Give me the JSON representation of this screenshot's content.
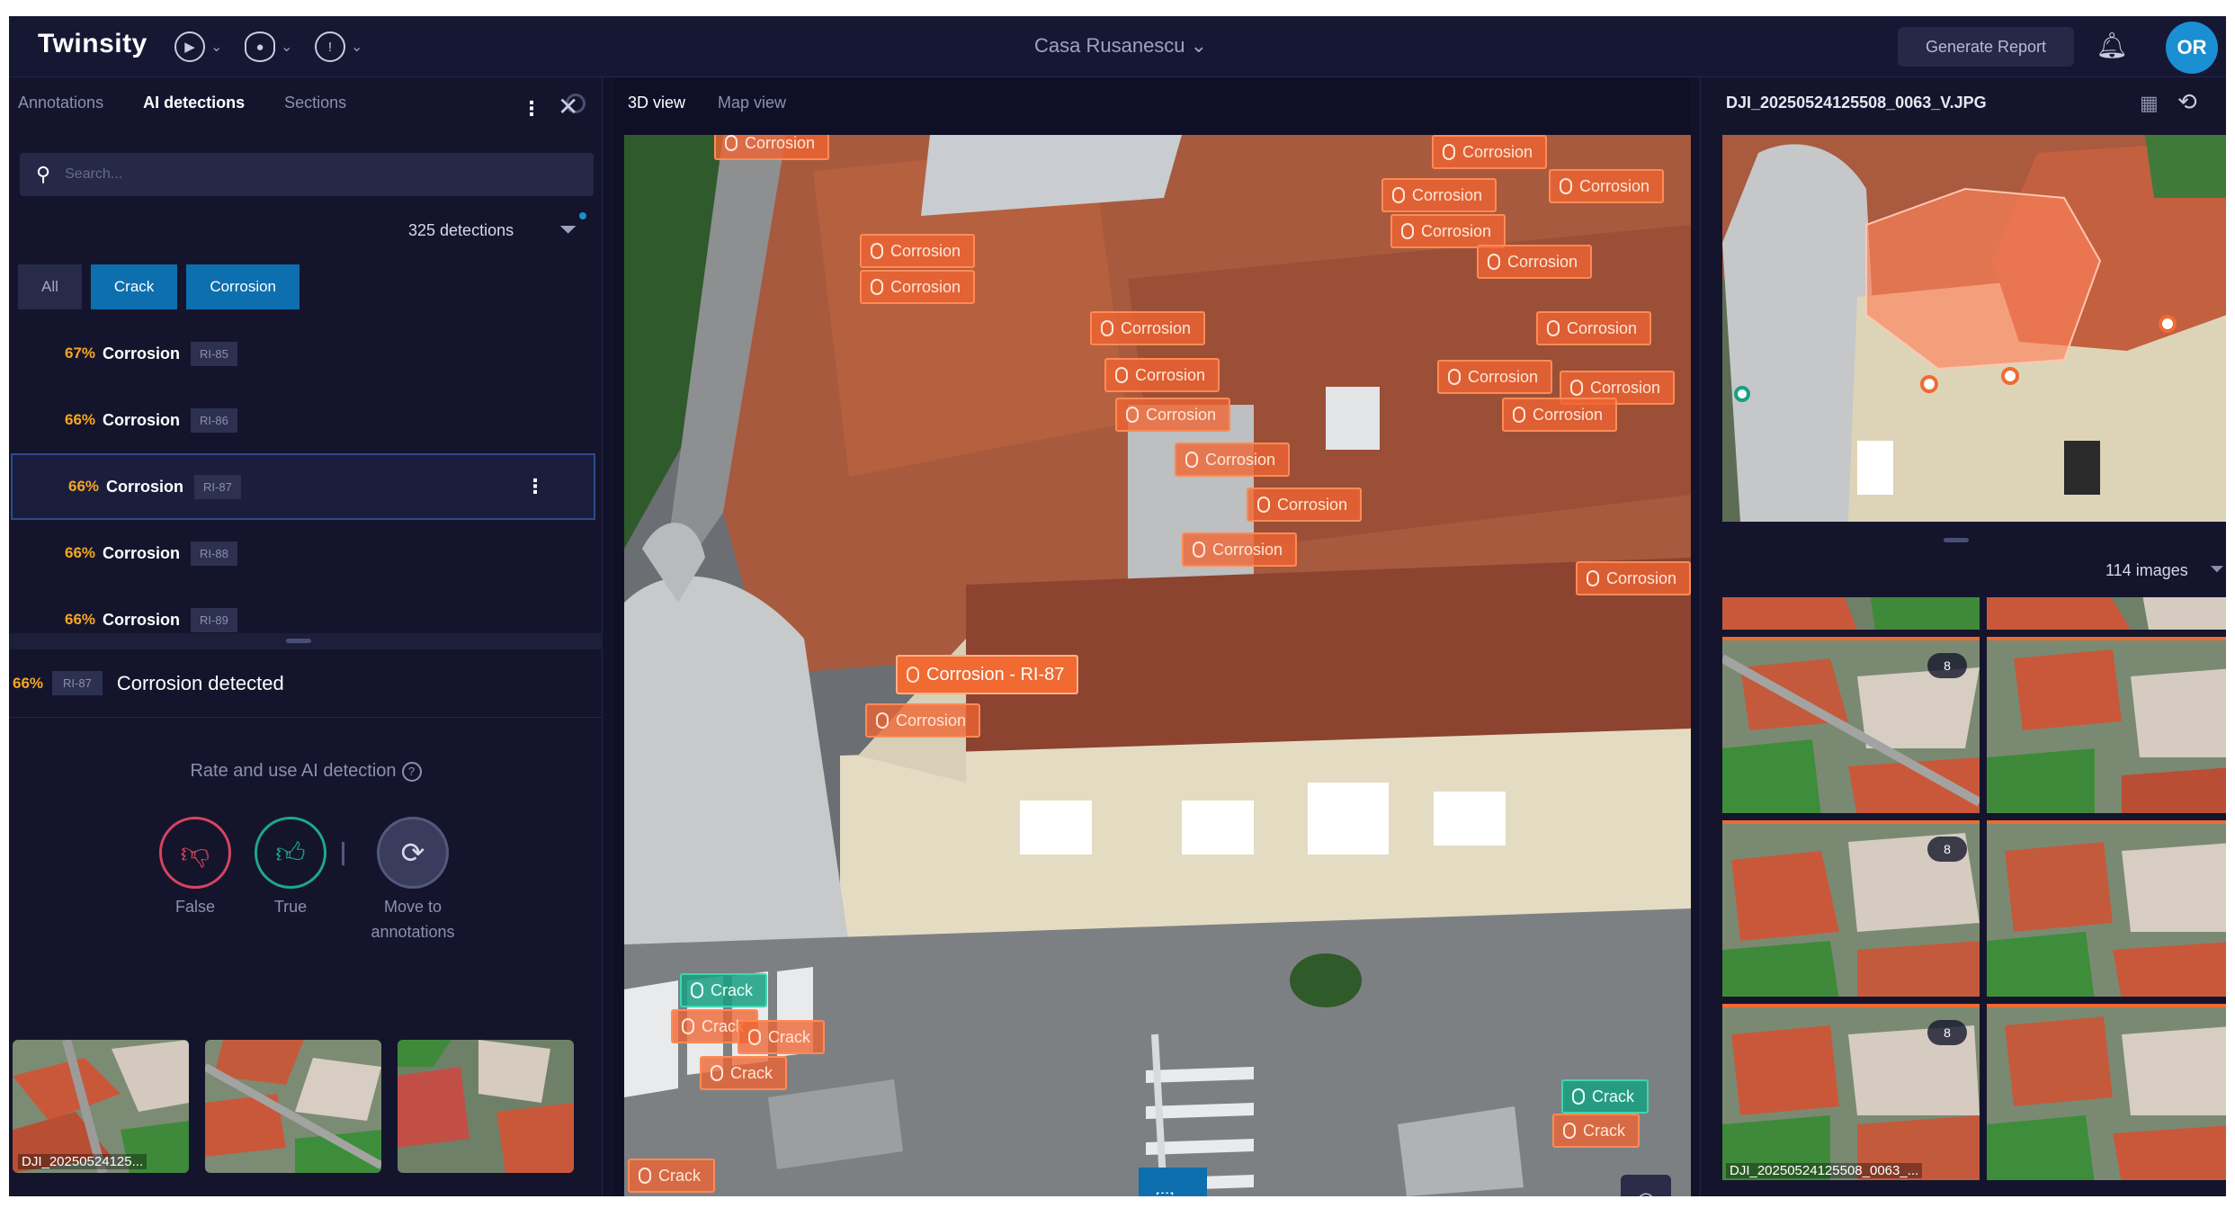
{
  "app": {
    "logo": "Twinsity",
    "project": "Casa Rusanescu ⌄",
    "generate_report": "Generate Report",
    "avatar_initials": "OR"
  },
  "left": {
    "tabs": [
      "Annotations",
      "AI detections",
      "Sections"
    ],
    "active_tab": "AI detections",
    "search_placeholder": "Search...",
    "detections_count": "325 detections",
    "filter_chips": [
      "All",
      "Crack",
      "Corrosion"
    ],
    "selected_chips": [
      "Crack",
      "Corrosion"
    ],
    "detections": [
      {
        "pct": "67%",
        "label": "Corrosion",
        "id": "RI-85"
      },
      {
        "pct": "66%",
        "label": "Corrosion",
        "id": "RI-86"
      },
      {
        "pct": "66%",
        "label": "Corrosion",
        "id": "RI-87",
        "selected": true
      },
      {
        "pct": "66%",
        "label": "Corrosion",
        "id": "RI-88"
      },
      {
        "pct": "66%",
        "label": "Corrosion",
        "id": "RI-89"
      }
    ],
    "detail": {
      "pct": "66%",
      "id": "RI-87",
      "title": "Corrosion detected",
      "rate_prompt": "Rate and use AI detection",
      "help_glyph": "?",
      "actions": {
        "false_label": "False",
        "true_label": "True",
        "move_label_line1": "Move to",
        "move_label_line2": "annotations"
      },
      "thumb_caption": "DJI_20250524125..."
    }
  },
  "center": {
    "tabs": [
      "3D view",
      "Map view"
    ],
    "active_tab": "3D view",
    "tags": [
      {
        "text": "Corrosion",
        "type": "corrosion"
      },
      {
        "text": "Corrosion",
        "type": "corrosion"
      },
      {
        "text": "Corrosion",
        "type": "corrosion"
      },
      {
        "text": "Corrosion",
        "type": "corrosion"
      },
      {
        "text": "Corrosion",
        "type": "corrosion"
      },
      {
        "text": "Corrosion",
        "type": "corrosion"
      },
      {
        "text": "Corrosion",
        "type": "corrosion"
      },
      {
        "text": "Corrosion",
        "type": "corrosion"
      },
      {
        "text": "Corrosion",
        "type": "corrosion"
      },
      {
        "text": "Corrosion",
        "type": "corrosion"
      },
      {
        "text": "Corrosion",
        "type": "corrosion"
      },
      {
        "text": "Corrosion",
        "type": "corrosion"
      },
      {
        "text": "Corrosion",
        "type": "corrosion"
      },
      {
        "text": "Corrosion",
        "type": "corrosion"
      },
      {
        "text": "Corrosion",
        "type": "corrosion"
      },
      {
        "text": "Corrosion",
        "type": "corrosion"
      },
      {
        "text": "Corrosion",
        "type": "corrosion"
      },
      {
        "text": "Corrosion",
        "type": "corrosion"
      },
      {
        "text": "Corrosion - RI-87",
        "type": "corrosion-selected"
      },
      {
        "text": "Corrosion",
        "type": "corrosion"
      },
      {
        "text": "Corrosion",
        "type": "corrosion"
      },
      {
        "text": "Crack",
        "type": "crack"
      },
      {
        "text": "Crack",
        "type": "corrosion"
      },
      {
        "text": "Crack",
        "type": "corrosion"
      },
      {
        "text": "Crack",
        "type": "corrosion"
      },
      {
        "text": "Crack",
        "type": "crack"
      },
      {
        "text": "Crack",
        "type": "corrosion"
      },
      {
        "text": "Crack",
        "type": "corrosion"
      }
    ]
  },
  "right": {
    "image_name": "DJI_20250524125508_0063_V.JPG",
    "images_count": "114 images",
    "gallery_badge": "8",
    "gallery_caption": "DJI_20250524125508_0063_..."
  },
  "colors": {
    "background": "#12132a",
    "accent_blue": "#0d6fae",
    "corrosion": "#f06a32",
    "crack": "#18a082",
    "confidence": "#f5a623"
  }
}
